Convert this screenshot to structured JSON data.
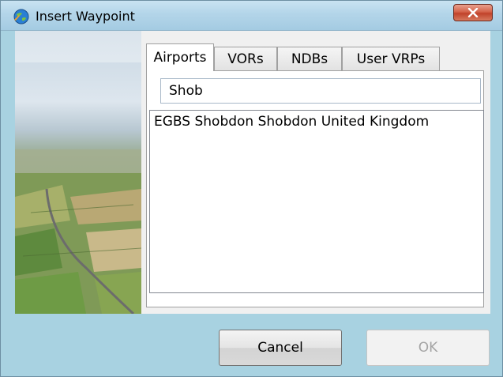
{
  "window": {
    "title": "Insert Waypoint",
    "close_glyph": "✕"
  },
  "tabs": [
    {
      "label": "Airports",
      "active": true
    },
    {
      "label": "VORs",
      "active": false
    },
    {
      "label": "NDBs",
      "active": false
    },
    {
      "label": "User VRPs",
      "active": false
    }
  ],
  "search": {
    "value": "Shob",
    "placeholder": ""
  },
  "results": [
    "EGBS Shobdon Shobdon United Kingdom"
  ],
  "buttons": {
    "cancel_label": "Cancel",
    "ok_label": "OK",
    "ok_enabled": false
  },
  "icons": {
    "title_icon": "globe-icon",
    "close_icon": "close-icon"
  },
  "colors": {
    "close_button": "#c94a30",
    "dialog_background": "#a8d2e1",
    "panel_background": "#f0f0f0"
  }
}
